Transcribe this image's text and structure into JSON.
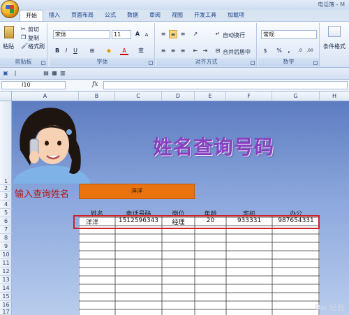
{
  "window": {
    "title": "电话簿 - M"
  },
  "tabs": [
    "开始",
    "插入",
    "页面布局",
    "公式",
    "数据",
    "审阅",
    "视图",
    "开发工具",
    "加载项"
  ],
  "ribbon": {
    "clipboard": {
      "label": "剪贴板",
      "paste": "粘贴",
      "cut": "剪切",
      "copy": "复制",
      "format_painter": "格式刷"
    },
    "font": {
      "label": "字体",
      "name": "宋体",
      "size": "11",
      "grow": "A",
      "shrink": "A",
      "bold": "B",
      "italic": "I",
      "underline": "U",
      "color_a": "A",
      "phonetic": "变"
    },
    "alignment": {
      "label": "对齐方式",
      "wrap": "自动换行",
      "merge": "合并后居中"
    },
    "number": {
      "label": "数字",
      "format": "常规",
      "percent": "%",
      "comma": ","
    },
    "styles": {
      "conditional": "条件格式"
    }
  },
  "formula_bar": {
    "name_box": "I10",
    "fx": "fx",
    "value": ""
  },
  "columns": [
    "A",
    "B",
    "C",
    "D",
    "E",
    "F",
    "G",
    "H"
  ],
  "rows": [
    "1",
    "2",
    "3",
    "4",
    "5",
    "6",
    "7",
    "8",
    "9",
    "10",
    "11",
    "12",
    "13",
    "14",
    "15",
    "16",
    "17"
  ],
  "sheet": {
    "title": "姓名查询号码",
    "input_label": "输入查询姓名",
    "input_value": "洋洋",
    "headers": [
      "姓名",
      "电话号码",
      "岗位",
      "年龄",
      "宅机",
      "办公"
    ],
    "record": [
      "洋洋",
      "1512596343",
      "经理",
      "20",
      "933331",
      "987654331"
    ]
  },
  "watermark": "Bai 经验"
}
